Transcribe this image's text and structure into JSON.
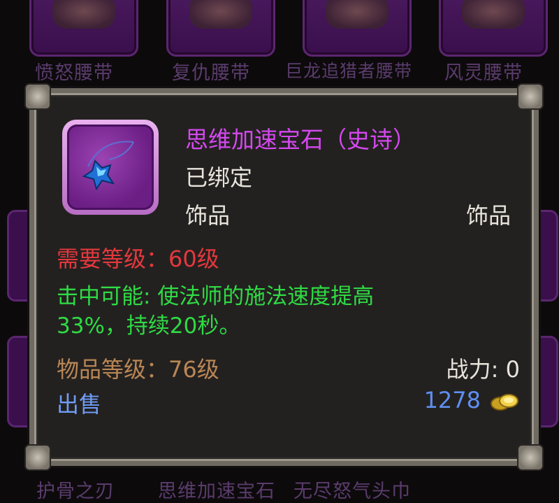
{
  "background_items": [
    {
      "label": "愤怒腰带"
    },
    {
      "label": "复仇腰带"
    },
    {
      "label": "巨龙追猎者腰带"
    },
    {
      "label": "风灵腰带"
    }
  ],
  "background_bottom_labels": [
    "护骨之刃",
    "思维加速宝石",
    "无尽怒气头巾"
  ],
  "tooltip": {
    "item_name": "思维加速宝石（史诗）",
    "bind_status": "已绑定",
    "slot_left": "饰品",
    "slot_right": "饰品",
    "required_level": "需要等级：60级",
    "effect": "击中可能: 使法师的施法速度提高\n33%，持续20秒。",
    "item_level": "物品等级：76级",
    "combat_power": "战力: 0",
    "sell_label": "出售",
    "sell_price": "1278",
    "icon": "blue-gem-necklace-icon",
    "coin_icon": "gold-coins-icon"
  },
  "colors": {
    "epic": "#d548f0",
    "requirement": "#e4383d",
    "effect": "#2fdb44",
    "item_level": "#b98655",
    "sell": "#6f9cf5",
    "price": "#5e8ff0"
  }
}
